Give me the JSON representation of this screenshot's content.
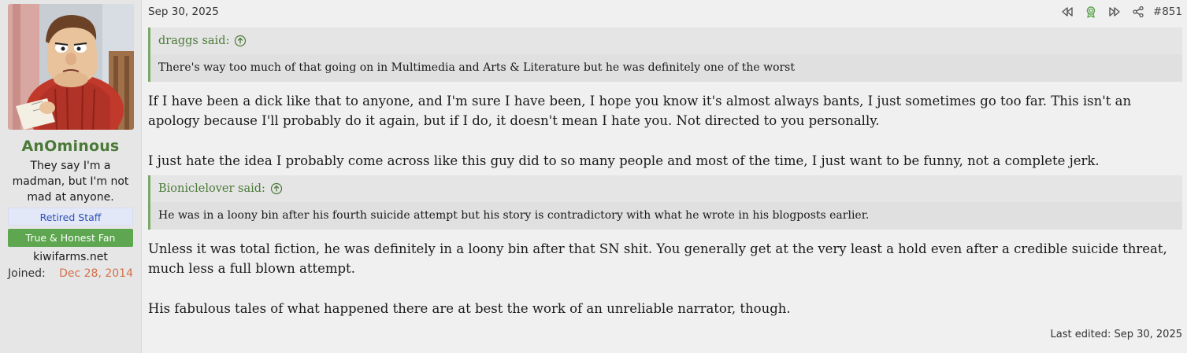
{
  "user": {
    "name": "AnOminous",
    "title": "They say I'm a madman, but I'm not mad at anyone.",
    "banners": [
      "Retired Staff",
      "True & Honest Fan"
    ],
    "site": "kiwifarms.net",
    "joined_label": "Joined:",
    "joined_date": "Dec 28, 2014"
  },
  "post": {
    "date": "Sep 30, 2025",
    "number": "#851",
    "actions": [
      "rewind-icon",
      "award-icon",
      "fast-forward-icon",
      "share-icon"
    ],
    "quote1": {
      "author": "draggs said:",
      "text": "There's way too much of that going on in Multimedia and Arts & Literature but he was definitely one of the worst"
    },
    "para1": "If I have been a dick like that to anyone, and I'm sure I have been, I hope you know it's almost always bants, I just sometimes go too far. This isn't an apology because I'll probably do it again, but if I do, it doesn't mean I hate you. Not directed to you personally.",
    "para2": "I just hate the idea I probably come across like this guy did to so many people and most of the time, I just want to be funny, not a complete jerk.",
    "quote2": {
      "author": "Bioniclelover said:",
      "text": "He was in a loony bin after his fourth suicide attempt but his story is contradictory with what he wrote in his blogposts earlier."
    },
    "para3": "Unless it was total fiction, he was definitely in a loony bin after that SN shit. You generally get at the very least a hold even after a credible suicide threat, much less a full blown attempt.",
    "para4": "His fabulous tales of what happened there are at best the work of an unreliable narrator, though.",
    "last_edited": "Last edited: Sep 30, 2025"
  },
  "colors": {
    "username": "#4b7a38",
    "quote_border": "#7aa866",
    "fan_banner": "#5ea650",
    "staff_banner": "#e3e8f8",
    "joined_date": "#d2714a"
  }
}
